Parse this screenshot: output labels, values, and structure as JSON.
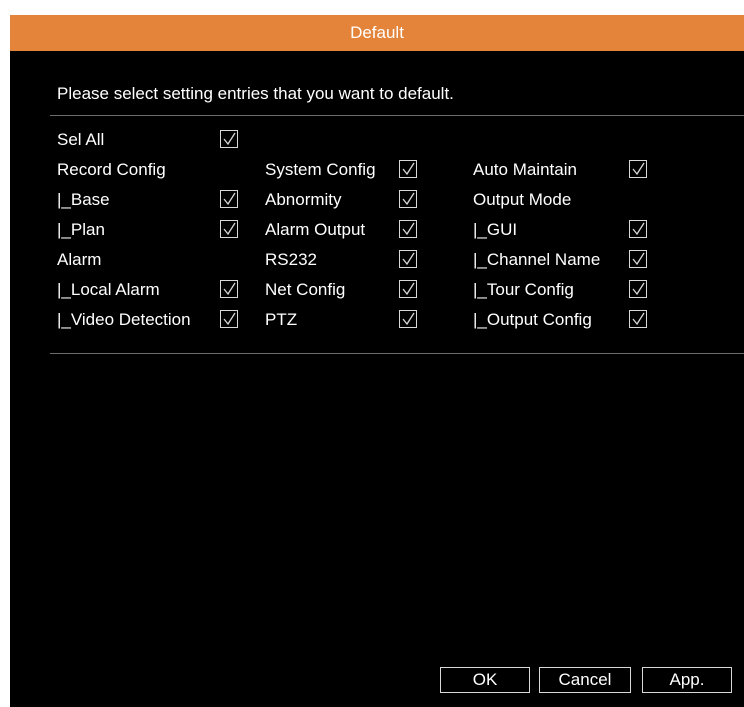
{
  "dialog": {
    "title": "Default",
    "prompt": "Please select setting entries that you want to default."
  },
  "sel_all": {
    "label": "Sel All",
    "checked": true
  },
  "col1": [
    {
      "label": "Record Config",
      "checkbox": false
    },
    {
      "label": "|_Base",
      "checkbox": true,
      "checked": true
    },
    {
      "label": "|_Plan",
      "checkbox": true,
      "checked": true
    },
    {
      "label": "Alarm",
      "checkbox": false
    },
    {
      "label": "|_Local Alarm",
      "checkbox": true,
      "checked": true
    },
    {
      "label": "|_Video Detection",
      "checkbox": true,
      "checked": true
    }
  ],
  "col2": [
    {
      "label": "System Config",
      "checkbox": true,
      "checked": true
    },
    {
      "label": "Abnormity",
      "checkbox": true,
      "checked": true
    },
    {
      "label": "Alarm Output",
      "checkbox": true,
      "checked": true
    },
    {
      "label": "RS232",
      "checkbox": true,
      "checked": true
    },
    {
      "label": "Net Config",
      "checkbox": true,
      "checked": true
    },
    {
      "label": "PTZ",
      "checkbox": true,
      "checked": true
    }
  ],
  "col3": [
    {
      "label": "Auto Maintain",
      "checkbox": true,
      "checked": true
    },
    {
      "label": "Output Mode",
      "checkbox": false
    },
    {
      "label": "|_GUI",
      "checkbox": true,
      "checked": true
    },
    {
      "label": "|_Channel Name",
      "checkbox": true,
      "checked": true
    },
    {
      "label": "|_Tour Config",
      "checkbox": true,
      "checked": true
    },
    {
      "label": "|_Output Config",
      "checkbox": true,
      "checked": true
    }
  ],
  "buttons": {
    "ok": "OK",
    "cancel": "Cancel",
    "apply": "App."
  },
  "colors": {
    "title_bar": "#e3843a",
    "background": "#000000",
    "text": "#ffffff"
  }
}
